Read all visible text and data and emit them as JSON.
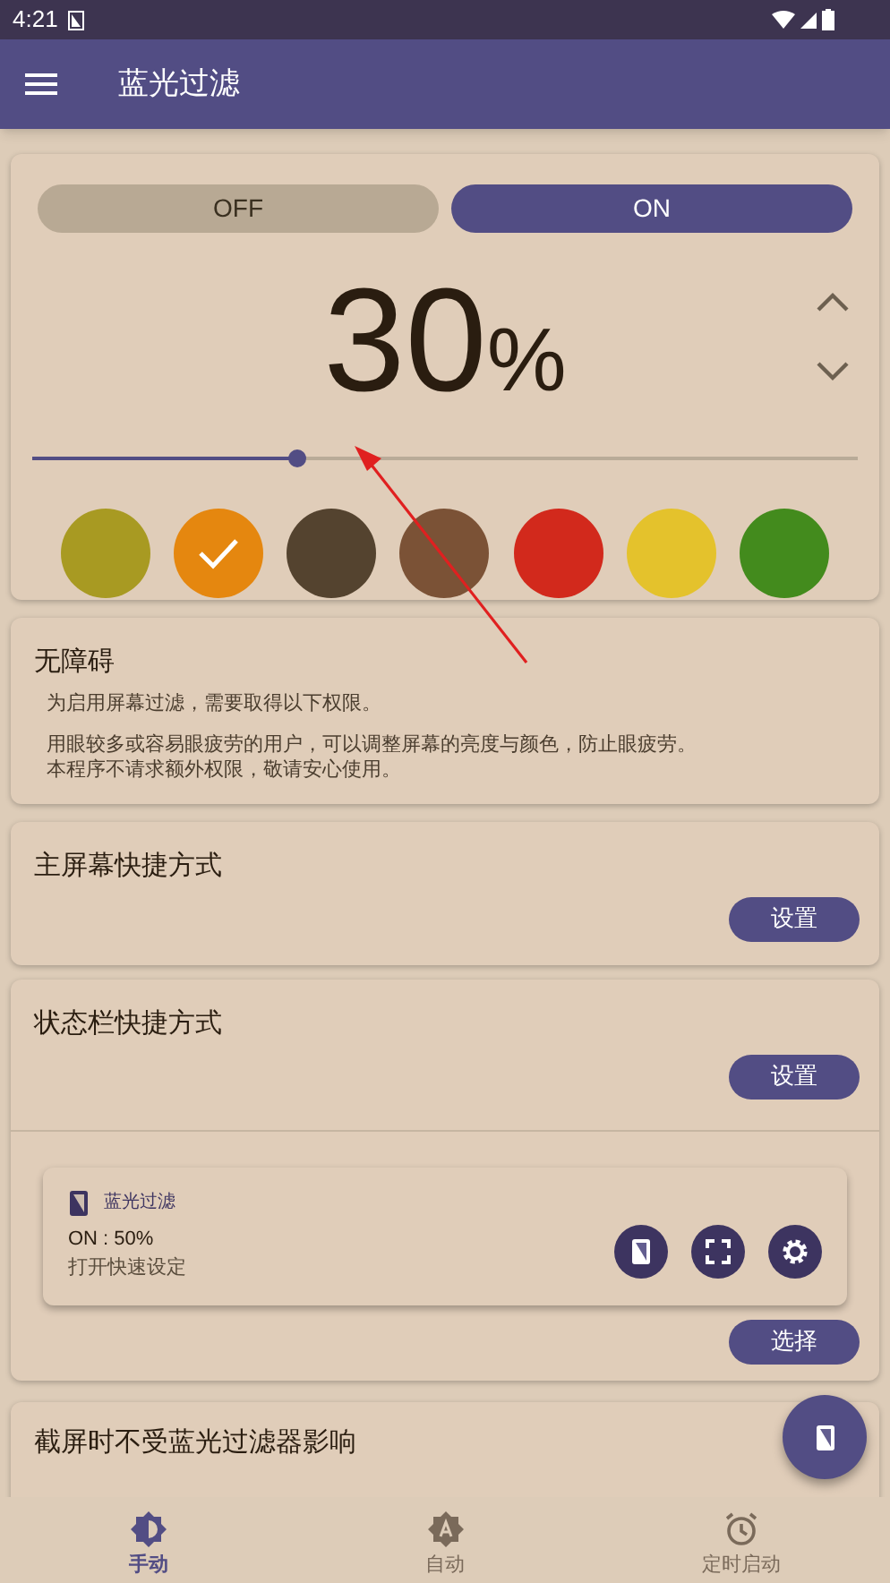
{
  "status_bar": {
    "time": "4:21"
  },
  "app_bar": {
    "title": "蓝光过滤"
  },
  "power_toggle": [
    {
      "label": "OFF",
      "selected": false
    },
    {
      "label": "ON",
      "selected": true
    }
  ],
  "intensity": {
    "value": "30",
    "unit": "%",
    "level": 0.32
  },
  "colors": [
    {
      "color": "#a89a22",
      "selected": false
    },
    {
      "color": "#e5870f",
      "selected": true
    },
    {
      "color": "#54432f",
      "selected": false
    },
    {
      "color": "#7b5236",
      "selected": false
    },
    {
      "color": "#d2291c",
      "selected": false
    },
    {
      "color": "#e4c22c",
      "selected": false
    },
    {
      "color": "#438b1d",
      "selected": false
    }
  ],
  "accessibility": {
    "title": "无障碍",
    "lines": [
      "为启用屏幕过滤，需要取得以下权限。",
      "用眼较多或容易眼疲劳的用户，可以调整屏幕的亮度与颜色，防止眼疲劳。",
      "本程序不请求额外权限，敬请安心使用。"
    ]
  },
  "home_shortcut": {
    "title": "主屏幕快捷方式",
    "button": "设置"
  },
  "statusbar_shortcut": {
    "title": "状态栏快捷方式",
    "button": "设置",
    "notification": {
      "app": "蓝光过滤",
      "status": "ON : 50%",
      "action": "打开快速设定"
    },
    "select_button": "选择"
  },
  "screenshot_setting": {
    "title": "截屏时不受蓝光过滤器影响"
  },
  "bottom_nav": [
    {
      "label": "手动",
      "kind": "brightness",
      "selected": true
    },
    {
      "label": "自动",
      "kind": "auto",
      "selected": false
    },
    {
      "label": "定时启动",
      "kind": "alarm",
      "selected": false
    }
  ]
}
